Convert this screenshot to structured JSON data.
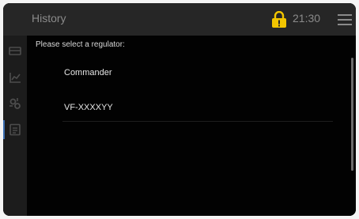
{
  "header": {
    "title": "History",
    "time": "21:30",
    "lock_icon": "lock-warning-icon",
    "menu_icon": "hamburger-menu-icon",
    "accent_color": "#f2c500"
  },
  "sidebar": {
    "items": [
      {
        "icon": "regulator-icon",
        "active": false
      },
      {
        "icon": "chart-icon",
        "active": false
      },
      {
        "icon": "settings-icon",
        "active": false
      },
      {
        "icon": "history-list-icon",
        "active": true
      }
    ],
    "active_color": "#3a6db0"
  },
  "main": {
    "prompt": "Please select a regulator:",
    "items": [
      "Commander",
      "VF-XXXXYY"
    ]
  }
}
